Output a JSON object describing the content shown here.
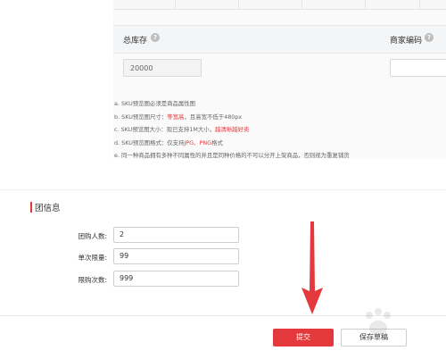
{
  "sku_table": {
    "total_stock_label": "总库存",
    "merchant_code_label": "商家编码",
    "total_stock_value": "20000",
    "merchant_code_value": ""
  },
  "notes": [
    {
      "prefix": "a.",
      "text": "SKU预览图必须是商品属性图",
      "red": "",
      "after": ""
    },
    {
      "prefix": "b.",
      "text": "SKU预览图尺寸：",
      "red": "等宽高",
      "after": "，且高宽不低于480px"
    },
    {
      "prefix": "c.",
      "text": "SKU预览图大小：现已支持1M大小，",
      "red": "越清晰越好卖",
      "after": ""
    },
    {
      "prefix": "d.",
      "text": "SKU预览图格式：仅支持",
      "red": "JPG、PNG",
      "after": "格式"
    },
    {
      "prefix": "e.",
      "text": "同一种商品拥有多种不同属性的并且是同种价格的不可以分开上架商品，否则视为重复铺货",
      "red": "",
      "after": ""
    }
  ],
  "group_section": {
    "title": "团信息",
    "fields": [
      {
        "label": "团购人数:",
        "value": "2"
      },
      {
        "label": "单次限量:",
        "value": "99"
      },
      {
        "label": "限购次数:",
        "value": "999"
      }
    ]
  },
  "actions": {
    "submit_label": "提交",
    "save_draft_label": "保存草稿"
  },
  "icons": {
    "help": "question-circle-icon",
    "arrow": "arrow-down-annotation"
  },
  "colors": {
    "accent": "#e4393c",
    "header_bg": "#f4f5f7"
  }
}
